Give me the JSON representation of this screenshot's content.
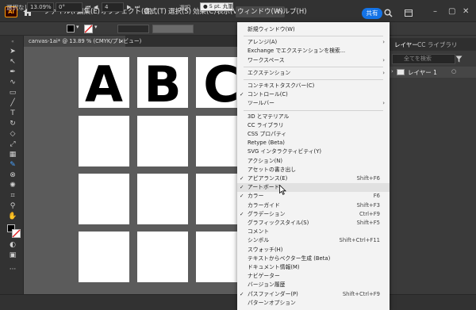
{
  "app": {
    "logo": "Ai"
  },
  "menubar": {
    "items": [
      "ファイル(F)",
      "編集(E)",
      "オブジェクト(O)",
      "書式(T)",
      "選択(S)",
      "効果(C)",
      "表示(V)",
      "ウィンドウ(W)",
      "ヘルプ(H)"
    ],
    "active_index": 7,
    "share_label": "共有"
  },
  "controlbar": {
    "selection_label": "選択なし",
    "stroke_label": "線：",
    "brush_label": "● 5 pt. 丸筆",
    "fill_color": "#000000",
    "stroke_color": "#ffffff"
  },
  "document": {
    "tab_title": "canvas-1ai* @ 13.89 % (CMYK/プレビュー)",
    "close_glyph": "×"
  },
  "artboards": {
    "rows": [
      [
        "A",
        "B",
        "C",
        ""
      ],
      [
        "",
        "",
        "",
        ""
      ],
      [
        "",
        "",
        "",
        ""
      ],
      [
        "",
        "",
        "",
        ""
      ]
    ]
  },
  "statusbar": {
    "zoom": "13.09%",
    "rotation": "0°",
    "artboard_number": "4",
    "mode_label": "選択"
  },
  "panel": {
    "tabs": [
      "レイヤー",
      "CC ライブラリ"
    ],
    "search_placeholder": "全てを検索",
    "layer_name": "レイヤー 1"
  },
  "window_menu": {
    "items": [
      {
        "label": "新規ウィンドウ(W)"
      },
      {
        "separator": true
      },
      {
        "label": "アレンジ(A)",
        "submenu": true
      },
      {
        "label": "Exchange でエクステンションを検索..."
      },
      {
        "label": "ワークスペース",
        "submenu": true
      },
      {
        "separator": true
      },
      {
        "label": "エクステンション",
        "submenu": true
      },
      {
        "separator": true
      },
      {
        "label": "コンテキストタスクバー(C)"
      },
      {
        "label": "コントロール(C)",
        "checked": true
      },
      {
        "label": "ツールバー",
        "submenu": true
      },
      {
        "separator": true
      },
      {
        "label": "3D とマテリアル"
      },
      {
        "label": "CC ライブラリ"
      },
      {
        "label": "CSS プロパティ"
      },
      {
        "label": "Retype (Beta)"
      },
      {
        "label": "SVG インタラクティビティ(Y)"
      },
      {
        "label": "アクション(N)"
      },
      {
        "label": "アセットの書き出し"
      },
      {
        "label": "アピアランス(E)",
        "checked": true,
        "shortcut": "Shift+F6"
      },
      {
        "label": "アートボード",
        "checked": true,
        "hover": true
      },
      {
        "label": "カラー",
        "checked": true,
        "shortcut": "F6"
      },
      {
        "label": "カラーガイド",
        "shortcut": "Shift+F3"
      },
      {
        "label": "グラデーション",
        "checked": true,
        "shortcut": "Ctrl+F9"
      },
      {
        "label": "グラフィックスタイル(S)",
        "shortcut": "Shift+F5"
      },
      {
        "label": "コメント"
      },
      {
        "label": "シンボル",
        "shortcut": "Shift+Ctrl+F11"
      },
      {
        "label": "スウォッチ(H)"
      },
      {
        "label": "テキストからベクター生成 (Beta)"
      },
      {
        "label": "ドキュメント情報(M)"
      },
      {
        "label": "ナビゲーター"
      },
      {
        "label": "バージョン履歴"
      },
      {
        "label": "パスファインダー(P)",
        "checked": true,
        "shortcut": "Shift+Ctrl+F9"
      },
      {
        "label": "パターンオプション"
      }
    ],
    "check_glyph": "✓",
    "submenu_glyph": "›"
  }
}
